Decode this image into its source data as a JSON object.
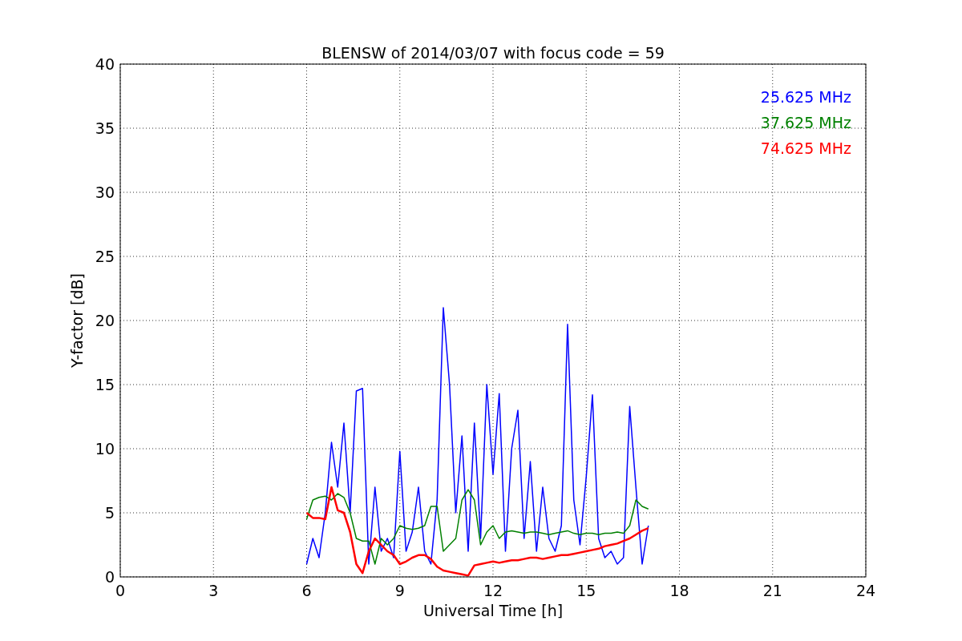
{
  "figure": {
    "chart_data": {
      "type": "line",
      "title": "BLENSW of 2014/03/07 with focus code = 59",
      "xlabel": "Universal Time [h]",
      "ylabel": "Y-factor [dB]",
      "x": [
        6.0,
        6.2,
        6.4,
        6.6,
        6.8,
        7.0,
        7.2,
        7.4,
        7.6,
        7.8,
        8.0,
        8.2,
        8.4,
        8.6,
        8.8,
        9.0,
        9.2,
        9.4,
        9.6,
        9.8,
        10.0,
        10.2,
        10.4,
        10.6,
        10.8,
        11.0,
        11.2,
        11.4,
        11.6,
        11.8,
        12.0,
        12.2,
        12.4,
        12.6,
        12.8,
        13.0,
        13.2,
        13.4,
        13.6,
        13.8,
        14.0,
        14.2,
        14.4,
        14.6,
        14.8,
        15.0,
        15.2,
        15.4,
        15.6,
        15.8,
        16.0,
        16.2,
        16.4,
        16.6,
        16.8,
        17.0
      ],
      "series": [
        {
          "name": "25.625 MHz",
          "color": "#0000ff",
          "values": [
            1,
            3,
            1.5,
            5,
            10.5,
            7,
            12,
            5,
            14.5,
            14.7,
            1,
            7,
            2,
            3,
            1.5,
            9.8,
            2,
            3.5,
            7,
            2,
            1,
            6,
            21,
            15,
            5,
            11,
            2,
            12,
            3,
            15,
            8,
            14.3,
            2,
            10,
            13,
            3,
            9,
            2,
            7,
            3,
            2,
            4,
            19.7,
            6,
            2.5,
            7.8,
            14.2,
            3,
            1.5,
            2,
            1,
            1.5,
            13.3,
            7,
            1,
            4
          ]
        },
        {
          "name": "37.625 MHz",
          "color": "#008000",
          "values": [
            4.5,
            6,
            6.2,
            6.3,
            6,
            6.5,
            6.2,
            5,
            3,
            2.8,
            2.8,
            1,
            3,
            2.5,
            3,
            4,
            3.8,
            3.7,
            3.8,
            4,
            5.5,
            5.5,
            2,
            2.5,
            3,
            6,
            6.8,
            6,
            2.5,
            3.5,
            4,
            3,
            3.5,
            3.6,
            3.5,
            3.4,
            3.5,
            3.5,
            3.4,
            3.3,
            3.4,
            3.5,
            3.6,
            3.4,
            3.3,
            3.4,
            3.4,
            3.3,
            3.4,
            3.4,
            3.5,
            3.4,
            4,
            6,
            5.5,
            5.3
          ]
        },
        {
          "name": "74.625 MHz",
          "color": "#ff0000",
          "values": [
            5,
            4.6,
            4.6,
            4.5,
            7,
            5.2,
            5,
            3.5,
            1,
            0.3,
            2,
            3,
            2.5,
            2,
            1.7,
            1,
            1.2,
            1.5,
            1.7,
            1.7,
            1.4,
            0.8,
            0.5,
            0.4,
            0.3,
            0.2,
            0.1,
            0.9,
            1,
            1.1,
            1.2,
            1.1,
            1.2,
            1.3,
            1.3,
            1.4,
            1.5,
            1.5,
            1.4,
            1.5,
            1.6,
            1.7,
            1.7,
            1.8,
            1.9,
            2,
            2.1,
            2.2,
            2.4,
            2.5,
            2.6,
            2.8,
            3,
            3.3,
            3.6,
            3.8
          ]
        }
      ],
      "grid": true,
      "xlim": [
        0,
        24
      ],
      "ylim": [
        0,
        40
      ],
      "xticks": [
        0,
        3,
        6,
        9,
        12,
        15,
        18,
        21,
        24
      ],
      "yticks": [
        0,
        5,
        10,
        15,
        20,
        25,
        30,
        35,
        40
      ]
    }
  }
}
